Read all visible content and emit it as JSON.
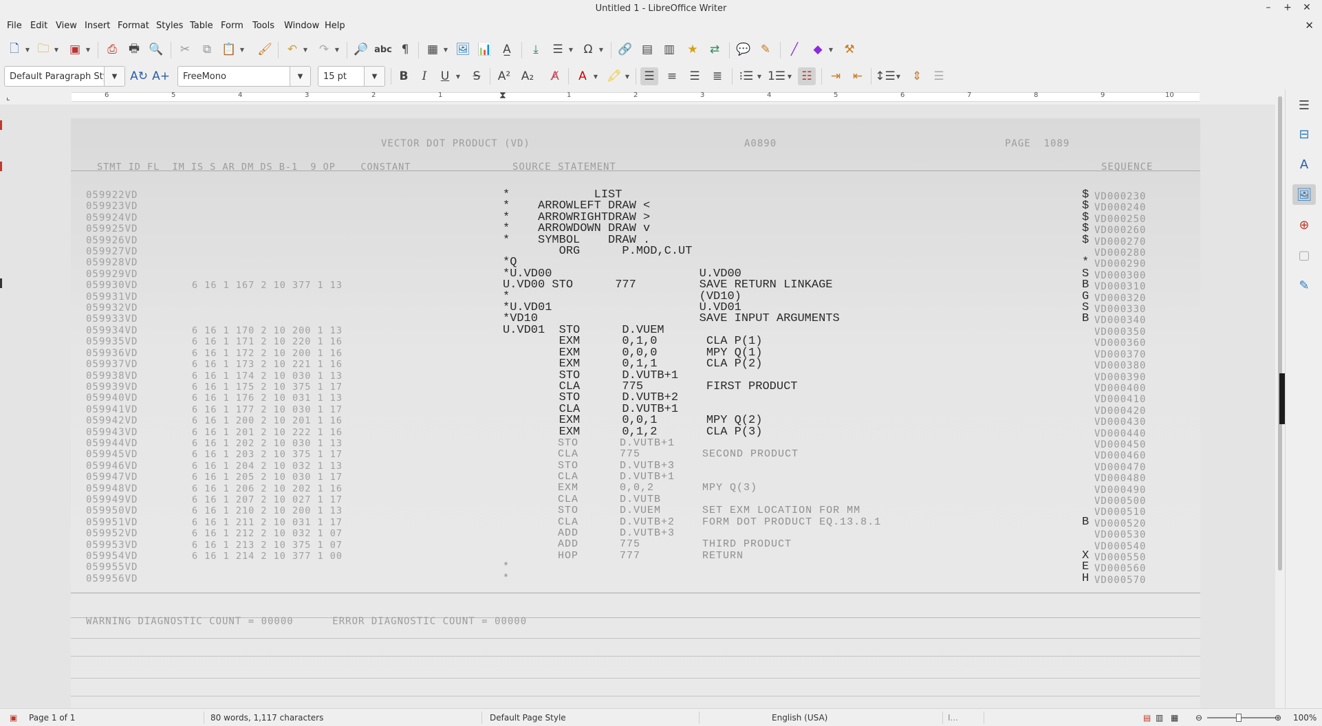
{
  "window": {
    "title": "Untitled 1 - LibreOffice Writer"
  },
  "menu": [
    "File",
    "Edit",
    "View",
    "Insert",
    "Format",
    "Styles",
    "Table",
    "Form",
    "Tools",
    "Window",
    "Help"
  ],
  "format_bar": {
    "paragraph_style": "Default Paragraph Sty",
    "font_name": "FreeMono",
    "font_size": "15 pt"
  },
  "ruler": {
    "numbers": [
      "6",
      "5",
      "4",
      "3",
      "2",
      "1",
      "1",
      "2",
      "3",
      "4",
      "5",
      "6",
      "7",
      "8",
      "9",
      "10"
    ]
  },
  "document": {
    "header_title": "VECTOR DOT PRODUCT (VD)",
    "header_code": "A0890",
    "header_page": "PAGE  1089",
    "column_header_left": "STMT ID FL  IM IS S AR DM DS B-1  9 OP    CONSTANT",
    "column_header_source": "SOURCE STATEMENT",
    "column_header_seq": "SEQUENCE",
    "stmt_ids": [
      "059922VD",
      "059923VD",
      "059924VD",
      "059925VD",
      "059926VD",
      "059927VD",
      "059928VD",
      "059929VD",
      "059930VD",
      "059931VD",
      "059932VD",
      "059933VD",
      "059934VD",
      "059935VD",
      "059936VD",
      "059937VD",
      "059938VD",
      "059939VD",
      "059940VD",
      "059941VD",
      "059942VD",
      "059943VD",
      "059944VD",
      "059945VD",
      "059946VD",
      "059947VD",
      "059948VD",
      "059949VD",
      "059950VD",
      "059951VD",
      "059952VD",
      "059953VD",
      "059954VD",
      "059955VD",
      "059956VD"
    ],
    "octal_codes": [
      "",
      "",
      "",
      "",
      "",
      "",
      "",
      "",
      "6 16 1 167 2 10 377 1 13",
      "",
      "",
      "",
      "6 16 1 170 2 10 200 1 13",
      "6 16 1 171 2 10 220 1 16",
      "6 16 1 172 2 10 200 1 16",
      "6 16 1 173 2 10 221 1 16",
      "6 16 1 174 2 10 030 1 13",
      "6 16 1 175 2 10 375 1 17",
      "6 16 1 176 2 10 031 1 13",
      "6 16 1 177 2 10 030 1 17",
      "6 16 1 200 2 10 201 1 16",
      "6 16 1 201 2 10 222 1 16",
      "6 16 1 202 2 10 030 1 13",
      "6 16 1 203 2 10 375 1 17",
      "6 16 1 204 2 10 032 1 13",
      "6 16 1 205 2 10 030 1 17",
      "6 16 1 206 2 10 202 1 16",
      "6 16 1 207 2 10 027 1 17",
      "6 16 1 210 2 10 200 1 13",
      "6 16 1 211 2 10 031 1 17",
      "6 16 1 212 2 10 032 1 07",
      "6 16 1 213 2 10 375 1 07",
      "6 16 1 214 2 10 377 1 00",
      "",
      ""
    ],
    "source_lines": [
      "*            LIST",
      "*    ARROWLEFT DRAW <",
      "*    ARROWRIGHTDRAW >",
      "*    ARROWDOWN DRAW v",
      "*    SYMBOL    DRAW .",
      "        ORG      P.MOD,C.UT",
      "*Q",
      "*U.VD00                     U.VD00",
      "U.VD00 STO      777         SAVE RETURN LINKAGE",
      "*                           (VD10)",
      "*U.VD01                     U.VD01",
      "*VD10                       SAVE INPUT ARGUMENTS",
      "U.VD01  STO      D.VUEM",
      "        EXM      0,1,0       CLA P(1)",
      "        EXM      0,0,0       MPY Q(1)",
      "        EXM      0,1,1       CLA P(2)",
      "        STO      D.VUTB+1",
      "        CLA      775         FIRST PRODUCT",
      "        STO      D.VUTB+2",
      "        CLA      D.VUTB+1",
      "        EXM      0,0,1       MPY Q(2)",
      "        EXM      0,1,2       CLA P(3)"
    ],
    "source_faint_lines": [
      "        STO      D.VUTB+1",
      "        CLA      775         SECOND PRODUCT",
      "        STO      D.VUTB+3",
      "        CLA      D.VUTB+1",
      "        EXM      0,0,2       MPY Q(3)",
      "        CLA      D.VUTB",
      "        STO      D.VUEM      SET EXM LOCATION FOR MM",
      "        CLA      D.VUTB+2    FORM DOT PRODUCT EQ.13.8.1",
      "        ADD      D.VUTB+3",
      "        ADD      775         THIRD PRODUCT",
      "        HOP      777         RETURN",
      "*",
      "*"
    ],
    "flags": [
      "$",
      "$",
      "$",
      "$",
      "$",
      "",
      "*",
      "S",
      "B",
      "G",
      "S",
      "B",
      "",
      "",
      "",
      "",
      "",
      "",
      "",
      "",
      "",
      "",
      "",
      "",
      "",
      "",
      "",
      "",
      "",
      "B",
      "",
      "",
      "X",
      "E",
      "H"
    ],
    "sequence": [
      "VD000230",
      "VD000240",
      "VD000250",
      "VD000260",
      "VD000270",
      "VD000280",
      "VD000290",
      "VD000300",
      "VD000310",
      "VD000320",
      "VD000330",
      "VD000340",
      "VD000350",
      "VD000360",
      "VD000370",
      "VD000380",
      "VD000390",
      "VD000400",
      "VD000410",
      "VD000420",
      "VD000430",
      "VD000440",
      "VD000450",
      "VD000460",
      "VD000470",
      "VD000480",
      "VD000490",
      "VD000500",
      "VD000510",
      "VD000520",
      "VD000530",
      "VD000540",
      "VD000550",
      "VD000560",
      "VD000570"
    ],
    "footer": "WARNING DIAGNOSTIC COUNT = 00000      ERROR DIAGNOSTIC COUNT = 00000"
  },
  "status": {
    "page": "Page 1 of 1",
    "words": "80 words, 1,117 characters",
    "page_style": "Default Page Style",
    "language": "English (USA)",
    "input_mode": "I...",
    "zoom": "100%"
  }
}
